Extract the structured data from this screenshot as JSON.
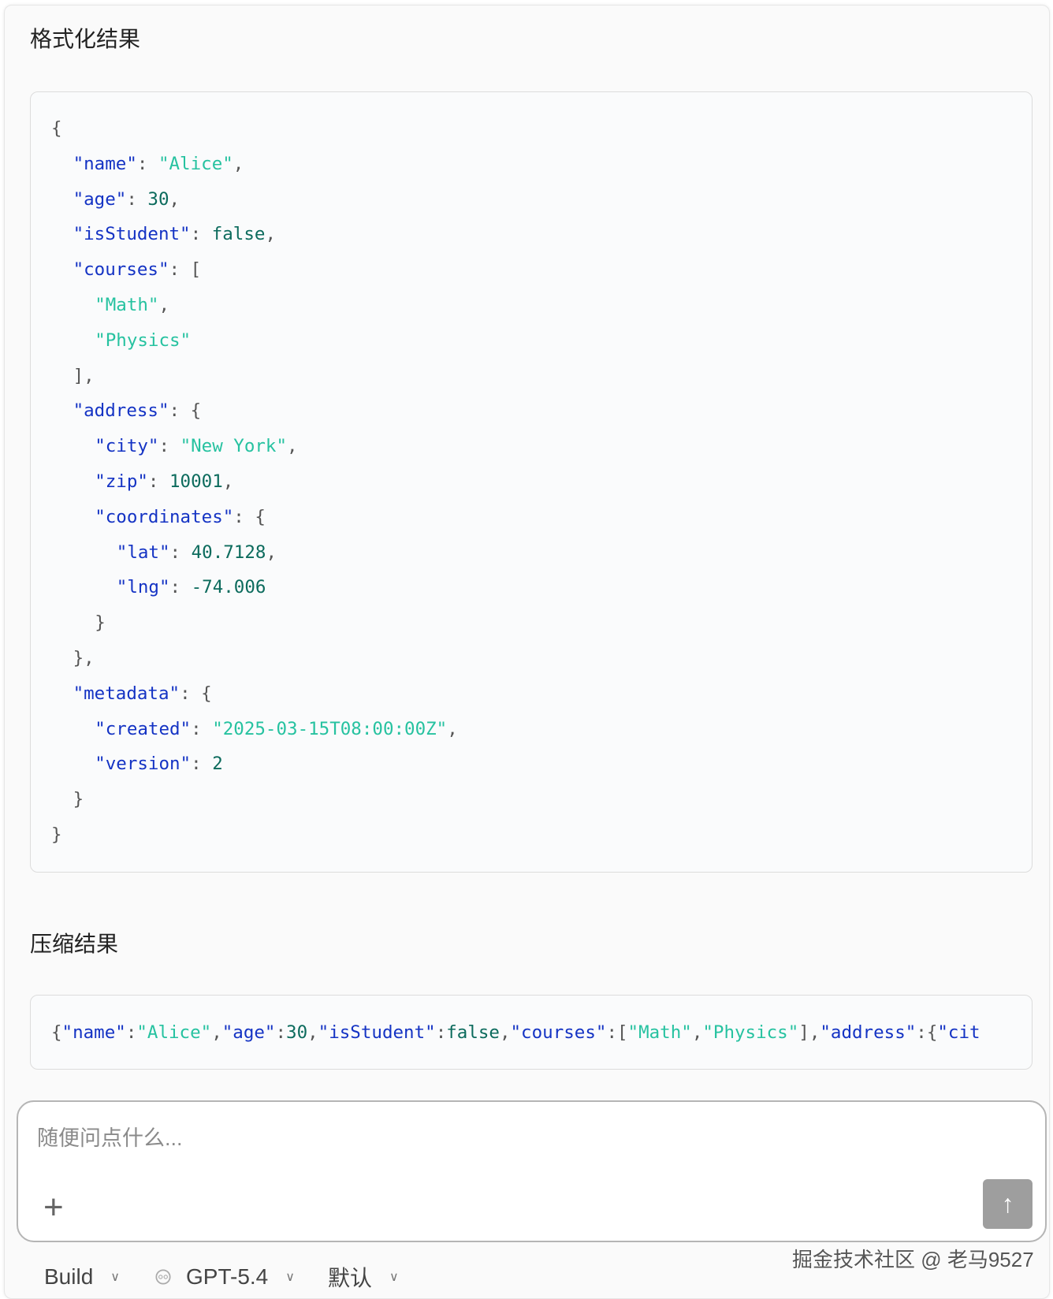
{
  "formatted": {
    "title": "格式化结果",
    "lines": [
      {
        "indent": 0,
        "tokens": [
          [
            "p",
            "{"
          ]
        ]
      },
      {
        "indent": 1,
        "tokens": [
          [
            "k",
            "\"name\""
          ],
          [
            "p",
            ": "
          ],
          [
            "s",
            "\"Alice\""
          ],
          [
            "p",
            ","
          ]
        ]
      },
      {
        "indent": 1,
        "tokens": [
          [
            "k",
            "\"age\""
          ],
          [
            "p",
            ": "
          ],
          [
            "n",
            "30"
          ],
          [
            "p",
            ","
          ]
        ]
      },
      {
        "indent": 1,
        "tokens": [
          [
            "k",
            "\"isStudent\""
          ],
          [
            "p",
            ": "
          ],
          [
            "n",
            "false"
          ],
          [
            "p",
            ","
          ]
        ]
      },
      {
        "indent": 1,
        "tokens": [
          [
            "k",
            "\"courses\""
          ],
          [
            "p",
            ": ["
          ]
        ]
      },
      {
        "indent": 2,
        "tokens": [
          [
            "s",
            "\"Math\""
          ],
          [
            "p",
            ","
          ]
        ]
      },
      {
        "indent": 2,
        "tokens": [
          [
            "s",
            "\"Physics\""
          ]
        ]
      },
      {
        "indent": 1,
        "tokens": [
          [
            "p",
            "],"
          ]
        ]
      },
      {
        "indent": 1,
        "tokens": [
          [
            "k",
            "\"address\""
          ],
          [
            "p",
            ": {"
          ]
        ]
      },
      {
        "indent": 2,
        "tokens": [
          [
            "k",
            "\"city\""
          ],
          [
            "p",
            ": "
          ],
          [
            "s",
            "\"New York\""
          ],
          [
            "p",
            ","
          ]
        ]
      },
      {
        "indent": 2,
        "tokens": [
          [
            "k",
            "\"zip\""
          ],
          [
            "p",
            ": "
          ],
          [
            "n",
            "10001"
          ],
          [
            "p",
            ","
          ]
        ]
      },
      {
        "indent": 2,
        "tokens": [
          [
            "k",
            "\"coordinates\""
          ],
          [
            "p",
            ": {"
          ]
        ]
      },
      {
        "indent": 3,
        "tokens": [
          [
            "k",
            "\"lat\""
          ],
          [
            "p",
            ": "
          ],
          [
            "n",
            "40.7128"
          ],
          [
            "p",
            ","
          ]
        ]
      },
      {
        "indent": 3,
        "tokens": [
          [
            "k",
            "\"lng\""
          ],
          [
            "p",
            ": "
          ],
          [
            "n",
            "-74.006"
          ]
        ]
      },
      {
        "indent": 2,
        "tokens": [
          [
            "p",
            "}"
          ]
        ]
      },
      {
        "indent": 1,
        "tokens": [
          [
            "p",
            "},"
          ]
        ]
      },
      {
        "indent": 1,
        "tokens": [
          [
            "k",
            "\"metadata\""
          ],
          [
            "p",
            ": {"
          ]
        ]
      },
      {
        "indent": 2,
        "tokens": [
          [
            "k",
            "\"created\""
          ],
          [
            "p",
            ": "
          ],
          [
            "s",
            "\"2025-03-15T08:00:00Z\""
          ],
          [
            "p",
            ","
          ]
        ]
      },
      {
        "indent": 2,
        "tokens": [
          [
            "k",
            "\"version\""
          ],
          [
            "p",
            ": "
          ],
          [
            "n",
            "2"
          ]
        ]
      },
      {
        "indent": 1,
        "tokens": [
          [
            "p",
            "}"
          ]
        ]
      },
      {
        "indent": 0,
        "tokens": [
          [
            "p",
            "}"
          ]
        ]
      }
    ]
  },
  "compressed": {
    "title": "压缩结果",
    "tokens": [
      [
        "p",
        "{"
      ],
      [
        "k",
        "\"name\""
      ],
      [
        "p",
        ":"
      ],
      [
        "s",
        "\"Alice\""
      ],
      [
        "p",
        ","
      ],
      [
        "k",
        "\"age\""
      ],
      [
        "p",
        ":"
      ],
      [
        "n",
        "30"
      ],
      [
        "p",
        ","
      ],
      [
        "k",
        "\"isStudent\""
      ],
      [
        "p",
        ":"
      ],
      [
        "n",
        "false"
      ],
      [
        "p",
        ","
      ],
      [
        "k",
        "\"courses\""
      ],
      [
        "p",
        ":["
      ],
      [
        "s",
        "\"Math\""
      ],
      [
        "p",
        ","
      ],
      [
        "s",
        "\"Physics\""
      ],
      [
        "p",
        "],"
      ],
      [
        "k",
        "\"address\""
      ],
      [
        "p",
        ":{"
      ],
      [
        "k",
        "\"cit"
      ]
    ]
  },
  "composer": {
    "placeholder": "随便问点什么...",
    "add_icon": "plus-icon",
    "send_icon": "arrow-up-icon"
  },
  "toolbar": {
    "mode": "Build",
    "model": "GPT-5.4",
    "preset": "默认"
  },
  "watermark": "掘金技术社区 @ 老马9527"
}
